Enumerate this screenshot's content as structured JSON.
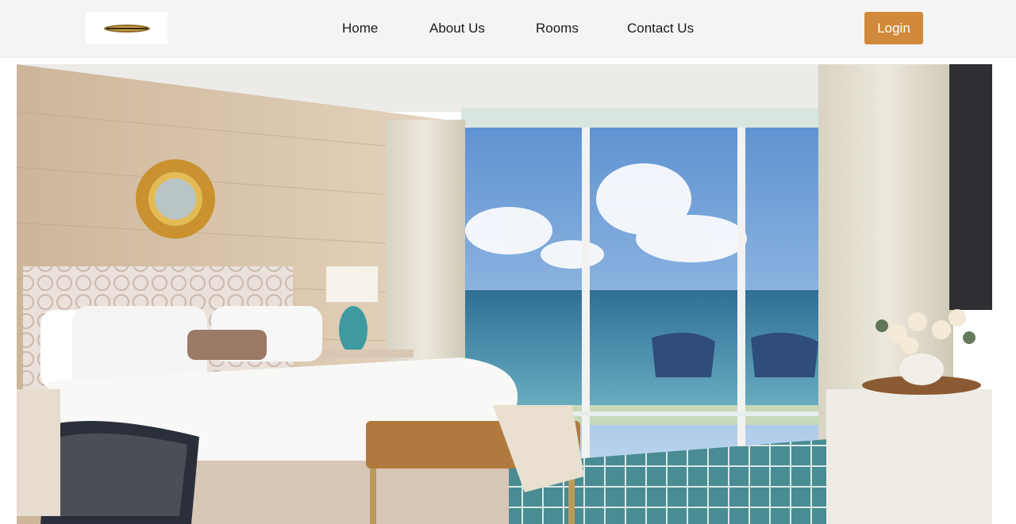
{
  "header": {
    "logo_icon": "hotel-logo-icon",
    "nav": [
      {
        "label": "Home"
      },
      {
        "label": "About Us"
      },
      {
        "label": "Rooms"
      },
      {
        "label": "Contact Us"
      }
    ],
    "login_label": "Login",
    "colors": {
      "navbar_bg": "#f4f4f4",
      "accent": "#d18a3c",
      "nav_text": "#1a1a1a"
    }
  },
  "hero": {
    "image": "hotel-room-ocean-view-image"
  }
}
